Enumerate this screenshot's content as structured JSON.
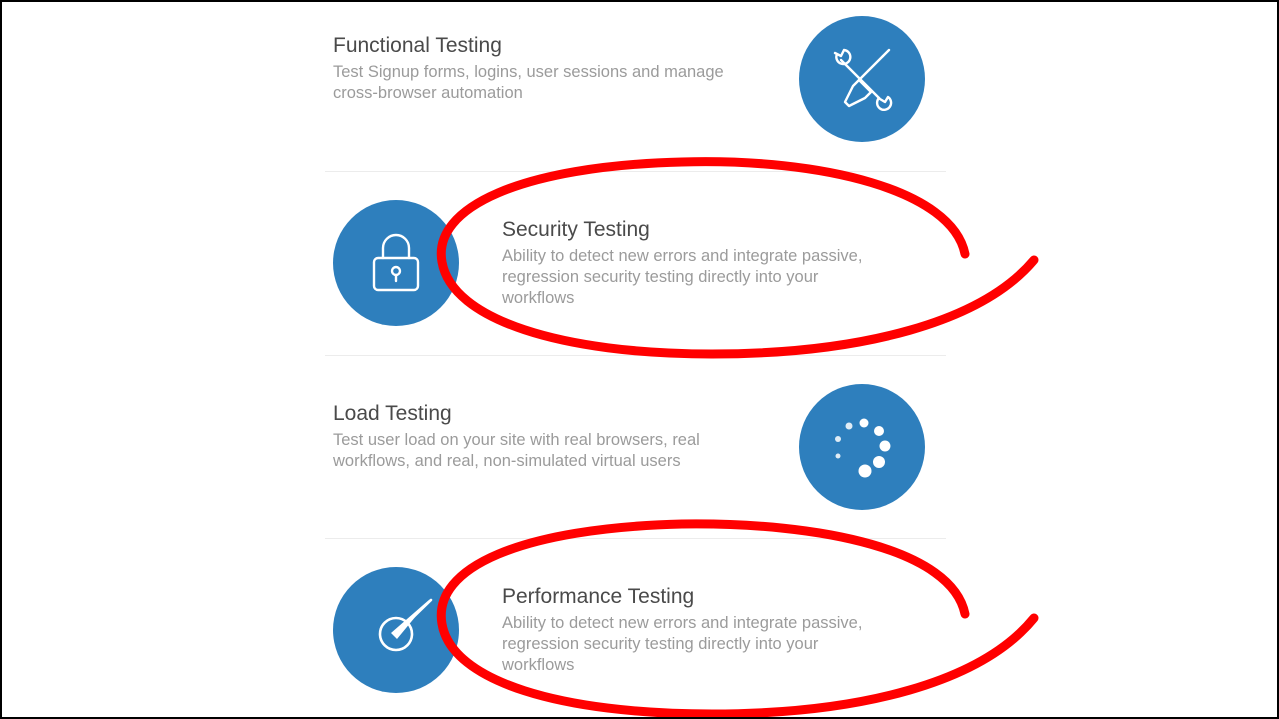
{
  "features": [
    {
      "title": "Functional Testing",
      "description": "Test Signup forms, logins, user sessions and manage cross-browser automation",
      "icon": "tools-icon"
    },
    {
      "title": "Security Testing",
      "description": "Ability to detect new errors and integrate passive, regression security testing directly into your workflows",
      "icon": "lock-icon"
    },
    {
      "title": "Load Testing",
      "description": "Test user load on your site with real browsers, real workflows, and real, non-simulated virtual users",
      "icon": "loading-spinner-icon"
    },
    {
      "title": "Performance Testing",
      "description": "Ability to detect new errors and integrate passive, regression security testing directly into your workflows",
      "icon": "speedometer-icon"
    }
  ],
  "colors": {
    "icon_circle": "#2e7fbd",
    "annotation": "#ff0000",
    "title_text": "#4a4a4a",
    "description_text": "#9b9b9b"
  }
}
